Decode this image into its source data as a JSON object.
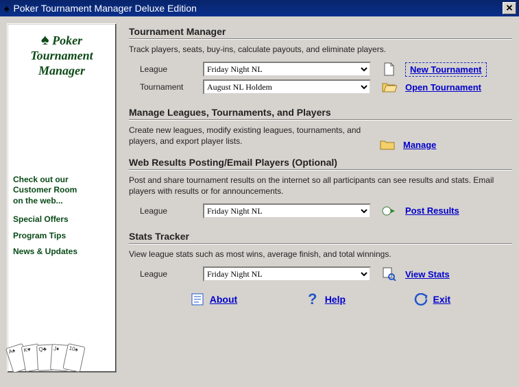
{
  "window": {
    "title": "Poker Tournament Manager Deluxe Edition"
  },
  "sidebar": {
    "logo_line1": "Poker",
    "logo_line2": "Tournament",
    "logo_line3": "Manager",
    "intro_line1": "Check out our",
    "intro_line2": "Customer Room",
    "intro_line3": "on the web...",
    "links": {
      "offers": "Special Offers",
      "tips": "Program Tips",
      "news": "News & Updates"
    }
  },
  "tournament_manager": {
    "title": "Tournament Manager",
    "desc": "Track players, seats, buy-ins, calculate payouts, and eliminate players.",
    "league_label": "League",
    "league_value": "Friday Night NL",
    "tournament_label": "Tournament",
    "tournament_value": "August NL Holdem",
    "new_tournament": "New Tournament",
    "open_tournament": "Open Tournament"
  },
  "manage": {
    "title": "Manage Leagues, Tournaments, and Players",
    "desc": "Create new leagues, modify existing leagues, tournaments, and players, and export player lists.",
    "link": "Manage"
  },
  "web_results": {
    "title": "Web Results Posting/Email Players (Optional)",
    "desc": "Post and share tournament results on the internet so all participants can see results and stats.  Email players with results or for announcements.",
    "league_label": "League",
    "league_value": "Friday Night NL",
    "link": "Post Results"
  },
  "stats": {
    "title": "Stats Tracker",
    "desc": "View league stats such as most wins, average finish, and total winnings.",
    "league_label": "League",
    "league_value": "Friday Night NL",
    "link": "View Stats"
  },
  "footer": {
    "about": "About",
    "help": "Help",
    "exit": "Exit"
  }
}
